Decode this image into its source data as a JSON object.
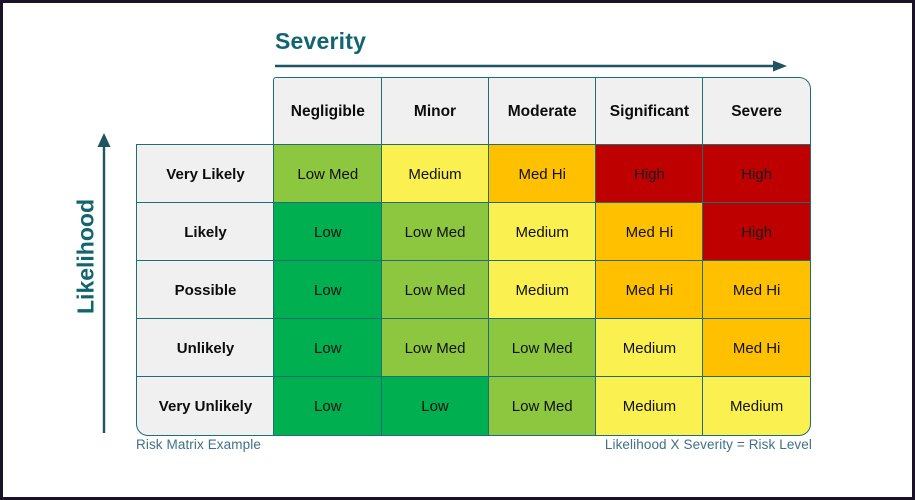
{
  "axes": {
    "severity": {
      "title": "Severity",
      "arrow_icon": "arrow-right-icon",
      "color": "#12656e"
    },
    "likelihood": {
      "title": "Likelihood",
      "arrow_icon": "arrow-up-icon",
      "color": "#12656e"
    }
  },
  "footer": {
    "left_note": "Risk Matrix Example",
    "right_note": "Likelihood X Severity = Risk Level",
    "color": "#3f7187"
  },
  "palette": {
    "low": "#00b050",
    "low_med": "#8dc63f",
    "medium": "#faf04f",
    "med_hi": "#ffc000",
    "high": "#be0000",
    "border": "#1f6e73",
    "header_bg": "#f0f0f0",
    "page_border": "#1a1226"
  },
  "chart_data": {
    "type": "heatmap",
    "title": "Risk Matrix Example",
    "xlabel": "Severity",
    "ylabel": "Likelihood",
    "categories": [
      "Negligible",
      "Minor",
      "Moderate",
      "Significant",
      "Severe"
    ],
    "rows": [
      "Very Likely",
      "Likely",
      "Possible",
      "Unlikely",
      "Very Unlikely"
    ],
    "levels": [
      "Low",
      "Low Med",
      "Medium",
      "Med Hi",
      "High"
    ],
    "level_colors": {
      "Low": "#00b050",
      "Low Med": "#8dc63f",
      "Medium": "#faf04f",
      "Med Hi": "#ffc000",
      "High": "#be0000"
    },
    "values": [
      [
        "Low Med",
        "Medium",
        "Med Hi",
        "High",
        "High"
      ],
      [
        "Low",
        "Low Med",
        "Medium",
        "Med Hi",
        "High"
      ],
      [
        "Low",
        "Low Med",
        "Medium",
        "Med Hi",
        "Med Hi"
      ],
      [
        "Low",
        "Low Med",
        "Low Med",
        "Medium",
        "Med Hi"
      ],
      [
        "Low",
        "Low",
        "Low Med",
        "Medium",
        "Medium"
      ]
    ],
    "grid": true,
    "legend": "none"
  }
}
